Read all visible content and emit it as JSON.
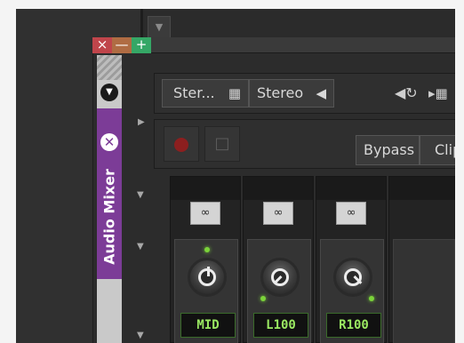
{
  "window_controls": {
    "close": "×",
    "minimize": "—",
    "maximize": "+"
  },
  "side_panel": {
    "title": "Audio Mixer",
    "collapse_glyph": "▼",
    "close_glyph": "✕",
    "accent": "#7c3c97"
  },
  "toolbar": {
    "preset_label": "Ster...",
    "output_label": "Stereo",
    "bypass_label": "Bypass",
    "clip_label": "Clip"
  },
  "icons": {
    "film": "film-icon",
    "speaker": "speaker-icon",
    "sync": "sync-icon",
    "record": "record-icon",
    "trash": "trash-icon",
    "link": "link-icon",
    "row_arrow": "triangle-right-icon",
    "row_arrow_down": "triangle-down-icon"
  },
  "channels": [
    {
      "label": "MID",
      "knob_angle": 0
    },
    {
      "label": "L100",
      "knob_angle": -135
    },
    {
      "label": "R100",
      "knob_angle": 135
    }
  ],
  "colors": {
    "led": "#7bd33a",
    "label_text": "#9bea62",
    "record": "#8c1f1f"
  }
}
